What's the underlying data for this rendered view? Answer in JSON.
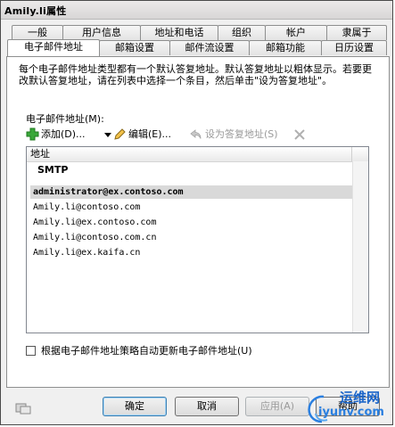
{
  "window": {
    "title": "Amily.li属性"
  },
  "tabs_back": [
    {
      "label": "一般"
    },
    {
      "label": "用户信息"
    },
    {
      "label": "地址和电话"
    },
    {
      "label": "组织"
    },
    {
      "label": "帐户"
    },
    {
      "label": "隶属于"
    }
  ],
  "tabs_front": [
    {
      "label": "电子邮件地址",
      "active": true
    },
    {
      "label": "邮箱设置"
    },
    {
      "label": "邮件流设置"
    },
    {
      "label": "邮箱功能"
    },
    {
      "label": "日历设置"
    }
  ],
  "main": {
    "description": "每个电子邮件地址类型都有一个默认答复地址。默认答复地址以粗体显示。若要更改默认答复地址，请在列表中选择一个条目，然后单击\"设为答复地址\"。",
    "section_label": "电子邮件地址(M):",
    "toolbar": {
      "add_label": "添加(D)...",
      "edit_label": "编辑(E)...",
      "set_reply_label": "设为答复地址(S)"
    },
    "list": {
      "column_header": "地址",
      "group_label": "SMTP",
      "rows": [
        {
          "address": "administrator@ex.contoso.com",
          "selected": true
        },
        {
          "address": "Amily.li@contoso.com"
        },
        {
          "address": "Amily.li@ex.contoso.com"
        },
        {
          "address": "Amily.li@contoso.com.cn"
        },
        {
          "address": "Amily.li@ex.kaifa.cn"
        }
      ]
    },
    "auto_update_label": "根据电子邮件地址策略自动更新电子邮件地址(U)"
  },
  "buttons": {
    "ok_label": "确定",
    "cancel_label": "取消",
    "apply_label": "应用(A)",
    "help_label": "帮助"
  },
  "watermark": {
    "line1": "运维网",
    "line2": "iyunv.com"
  },
  "colors": {
    "add_icon": "#3aa83a",
    "selection": "#d9d9d9",
    "watermark": "#1a64c8"
  }
}
